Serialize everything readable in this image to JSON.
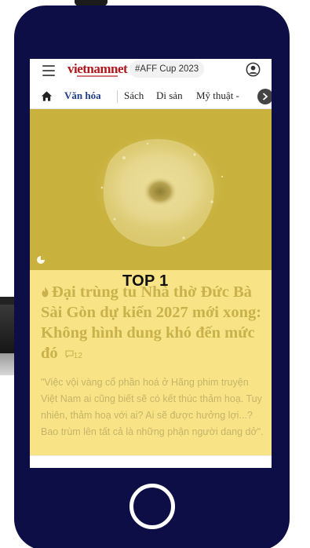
{
  "header": {
    "logo_text": "vietnamnet",
    "hashtag": "#AFF Cup 2023"
  },
  "categories": {
    "active": "Văn hóa",
    "items": [
      "Sách",
      "Di sản",
      "Mỹ thuật -"
    ]
  },
  "article": {
    "rank_label": "TOP 1",
    "headline": "Đại trùng tu Nhà thờ Đức Bà Sài Gòn dự kiến 2027 mới xong: Không hình dung khó đến mức đó",
    "comment_count": "12",
    "summary": "\"Việc vội vàng cổ phần hoá ở Hãng phim truyện Việt Nam ai cũng biết sẽ có kết thúc thảm hoạ. Tuy nhiên, thảm hoạ với ai? Ai sẽ được hưởng lợi...? Bao trùm lên tất cả là những phận người dang dở\"."
  },
  "icons": [
    "menu-icon",
    "user-icon",
    "home-icon",
    "chevron-right-icon",
    "fire-icon",
    "comment-icon",
    "badge-icon"
  ],
  "colors": {
    "phone_frame": "#0d0e45",
    "card_bg": "#f8e486",
    "hero_bg": "#c8b13c",
    "active_category": "#1f3c88",
    "logo_red": "#b3161b"
  }
}
